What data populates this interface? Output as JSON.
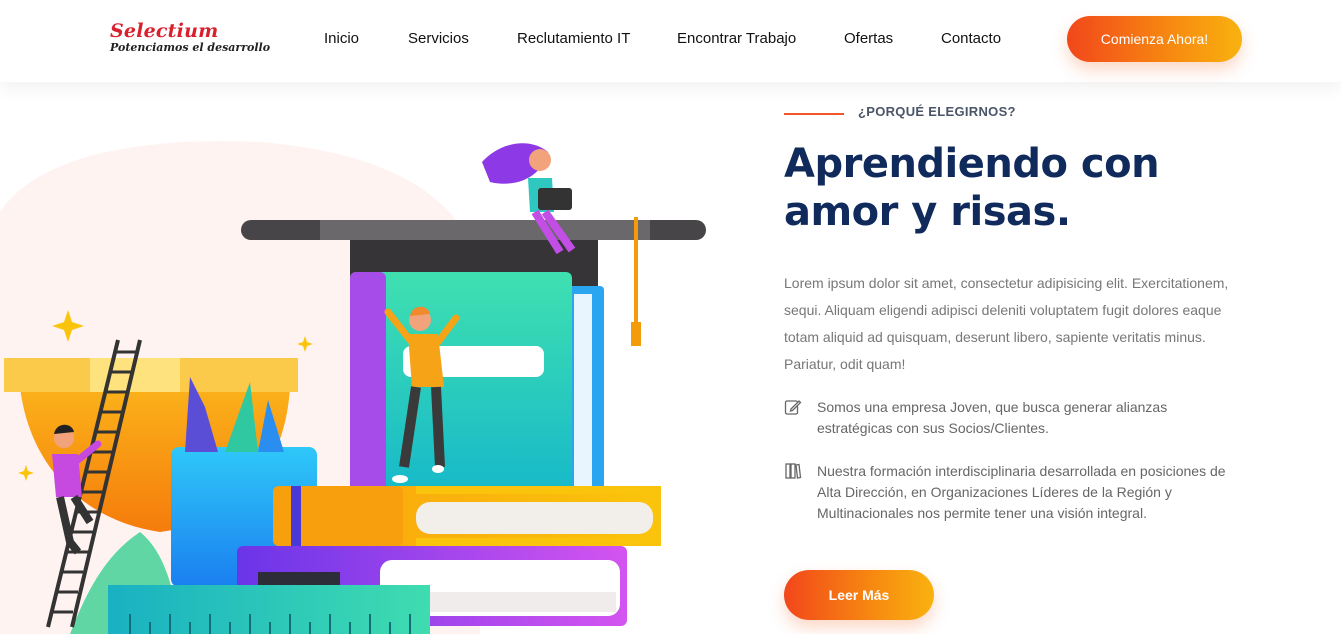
{
  "header": {
    "logo_title": "Selectium",
    "logo_tagline": "Potenciamos el desarrollo",
    "nav": [
      {
        "label": "Inicio"
      },
      {
        "label": "Servicios"
      },
      {
        "label": "Reclutamiento IT"
      },
      {
        "label": "Encontrar Trabajo"
      },
      {
        "label": "Ofertas"
      },
      {
        "label": "Contacto"
      }
    ],
    "cta_label": "Comienza Ahora!"
  },
  "about": {
    "eyebrow": "¿PORQUÉ ELEGIRNOS?",
    "headline": "Aprendiendo con amor y risas.",
    "paragraph": "Lorem ipsum dolor sit amet, consectetur adipisicing elit. Exercitationem, sequi. Aliquam eligendi adipisci deleniti voluptatem fugit dolores eaque totam aliquid ad quisquam, deserunt libero, sapiente veritatis minus. Pariatur, odit quam!",
    "features": [
      {
        "icon": "edit-icon",
        "text": "Somos una empresa Joven, que busca generar alianzas estratégicas con sus Socios/Clientes."
      },
      {
        "icon": "books-icon",
        "text": "Nuestra formación interdisciplinaria desarrollada en posiciones de Alta Dirección, en Organizaciones Líderes de la Región y Multinacionales nos permite tener una visión integral."
      }
    ],
    "button_label": "Leer Más"
  },
  "colors": {
    "accent_start": "#f2471b",
    "accent_end": "#f9b20f",
    "headline": "#102a5c"
  }
}
